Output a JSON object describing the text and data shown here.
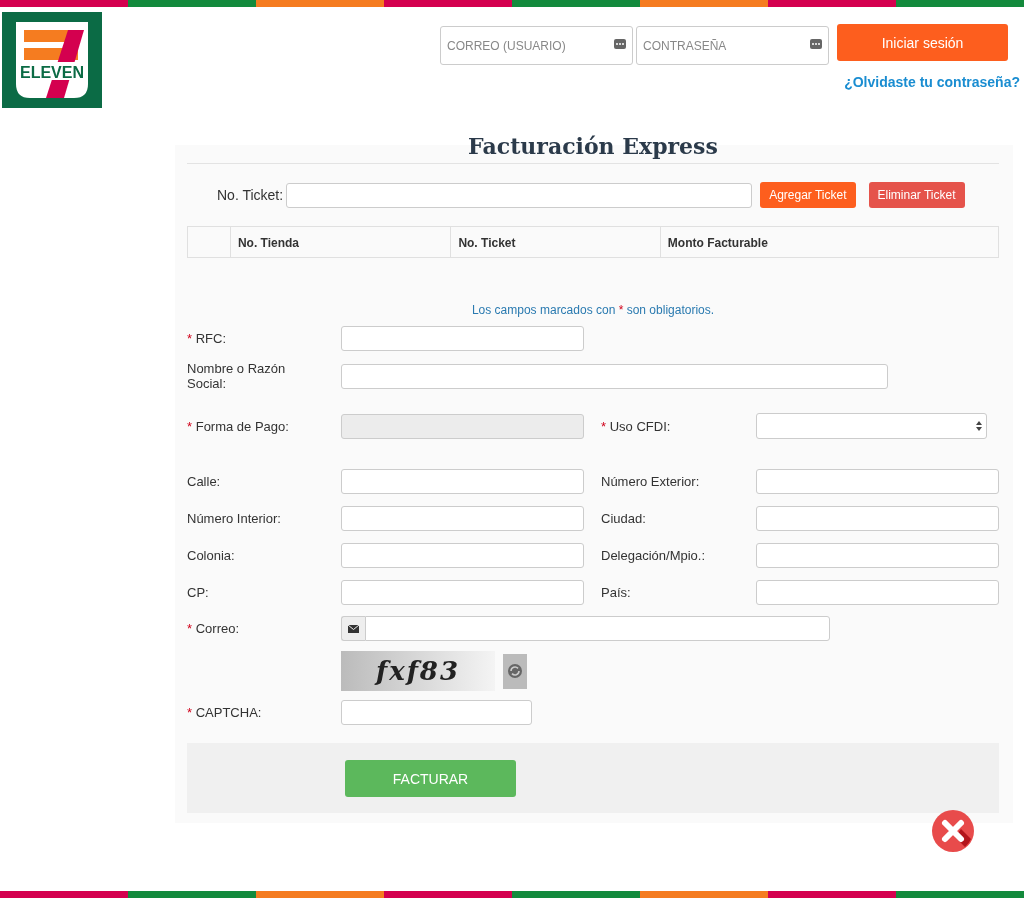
{
  "logo": {
    "text": "ELEVEN"
  },
  "login": {
    "email_placeholder": "CORREO (USUARIO)",
    "password_placeholder": "CONTRASEÑA",
    "button": "Iniciar sesión",
    "forgot_link": "¿Olvidaste tu contraseña?"
  },
  "title": "Facturación Express",
  "ticket": {
    "label": "No. Ticket:",
    "add_button": "Agregar Ticket",
    "remove_button": "Eliminar Ticket"
  },
  "table": {
    "columns": [
      "No. Tienda",
      "No. Ticket",
      "Monto Facturable"
    ]
  },
  "required_mark": "*",
  "required_note": {
    "before": "Los campos marcados con",
    "after": "son obligatorios."
  },
  "rows": [
    [
      {
        "label": "RFC:",
        "required": true,
        "kind": "text"
      }
    ],
    [
      {
        "label": "Nombre o Razón Social:",
        "required": false,
        "kind": "wide"
      }
    ],
    [
      {
        "label": "Forma de Pago:",
        "required": true,
        "kind": "disabled"
      },
      {
        "label": "Uso CFDI:",
        "required": true,
        "kind": "select"
      }
    ],
    [
      {
        "label": "Calle:",
        "required": false,
        "kind": "text"
      },
      {
        "label": "Número Exterior:",
        "required": false,
        "kind": "text"
      }
    ],
    [
      {
        "label": "Número Interior:",
        "required": false,
        "kind": "text"
      },
      {
        "label": "Ciudad:",
        "required": false,
        "kind": "text"
      }
    ],
    [
      {
        "label": "Colonia:",
        "required": false,
        "kind": "text"
      },
      {
        "label": "Delegación/Mpio.:",
        "required": false,
        "kind": "text"
      }
    ],
    [
      {
        "label": "CP:",
        "required": false,
        "kind": "text"
      },
      {
        "label": "País:",
        "required": false,
        "kind": "text"
      }
    ],
    [
      {
        "label": "Correo:",
        "required": true,
        "kind": "email"
      }
    ]
  ],
  "captcha": {
    "image_text": "fxf83",
    "label": "CAPTCHA:",
    "required": true
  },
  "submit": "FACTURAR"
}
